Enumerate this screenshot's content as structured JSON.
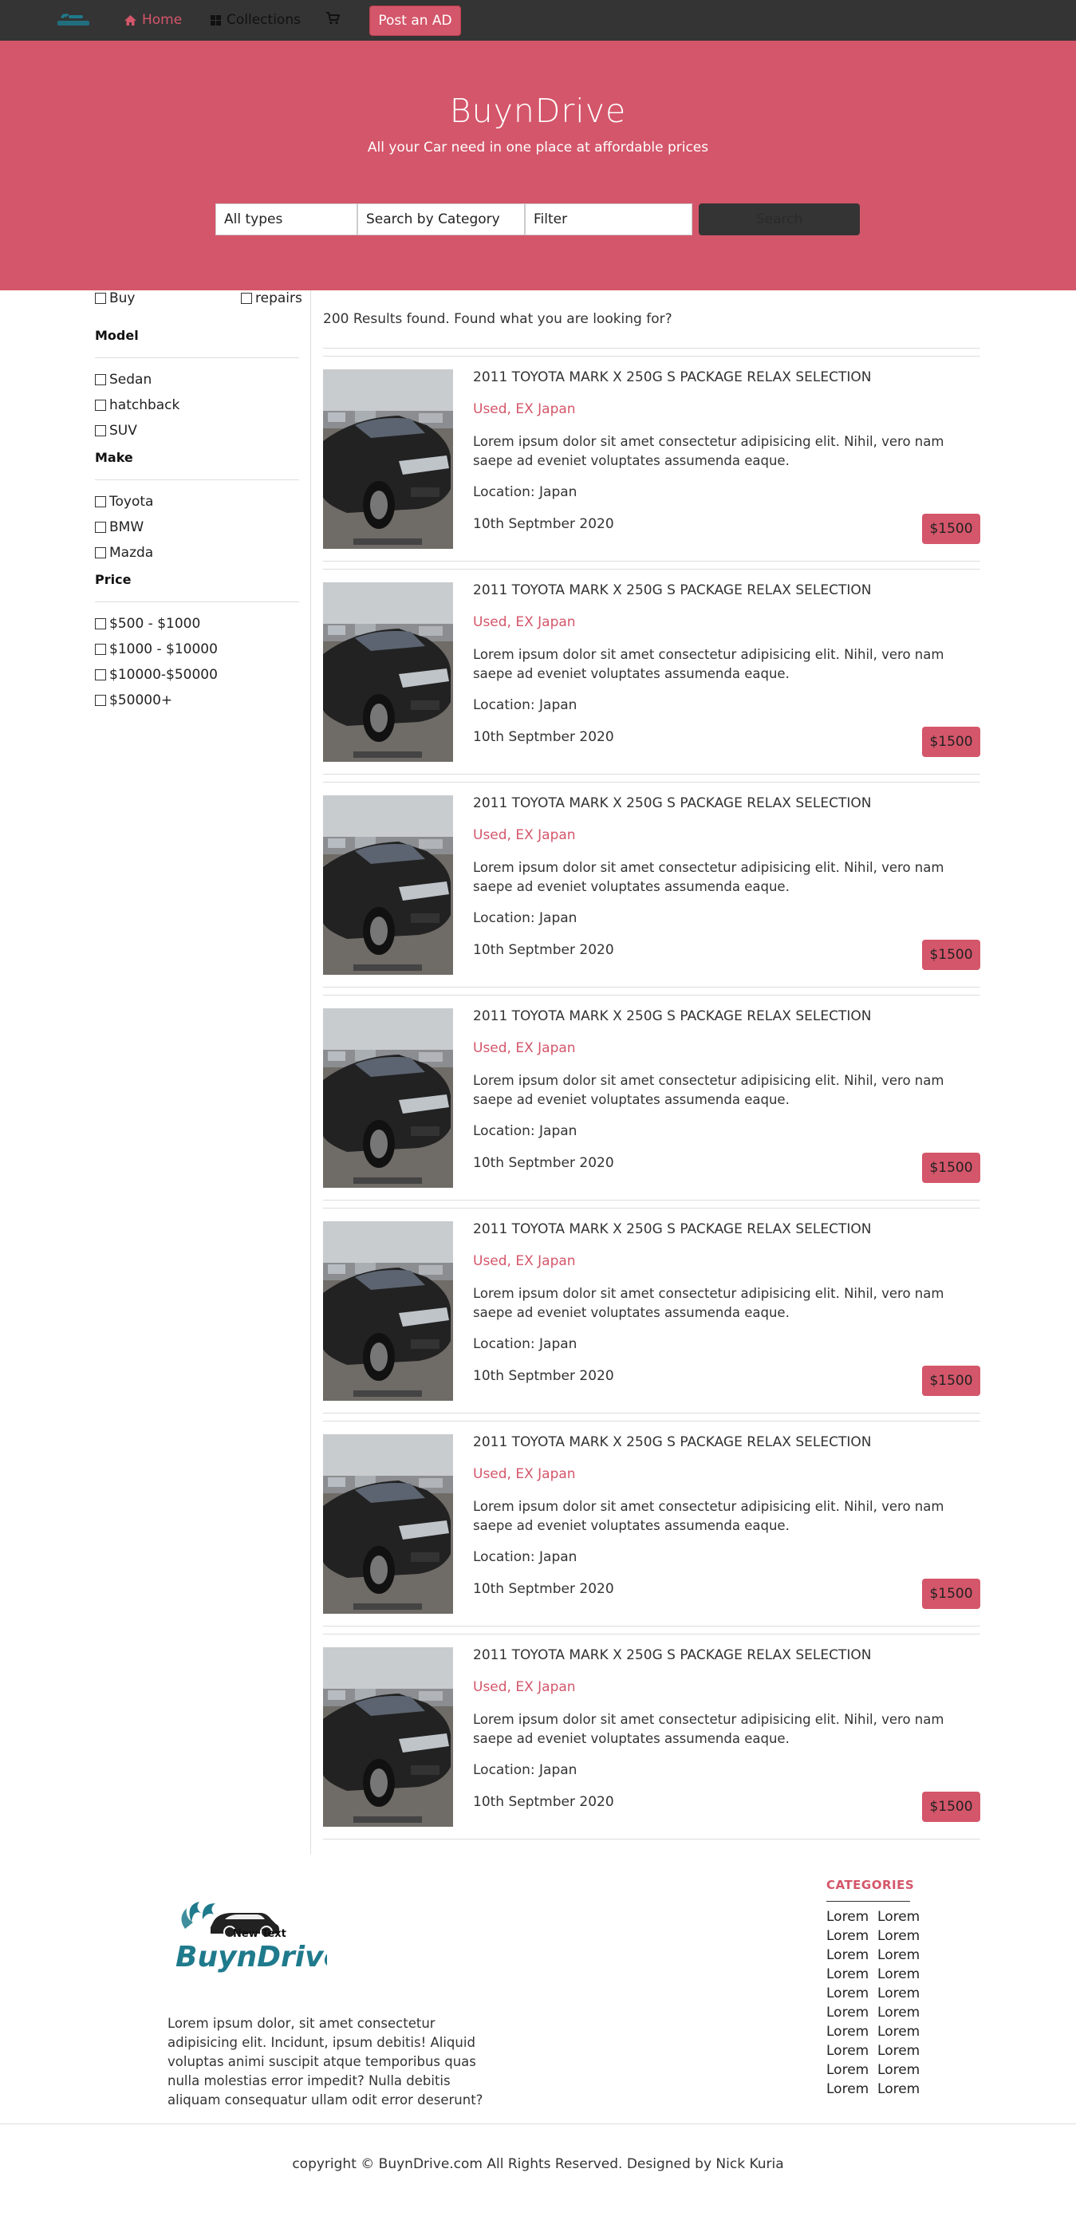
{
  "nav": {
    "home": "Home",
    "collections": "Collections",
    "post_ad": "Post an AD"
  },
  "hero": {
    "title": "BuynDrive",
    "subtitle": "All your Car need in one place at affordable prices",
    "select_types": "All types",
    "select_category": "Search by Category",
    "select_filter": "Filter",
    "search_button": "Search"
  },
  "sidebar": {
    "buy": "Buy",
    "repairs": "repairs",
    "model_heading": "Model",
    "models": [
      "Sedan",
      "hatchback",
      "SUV"
    ],
    "make_heading": "Make",
    "makes": [
      "Toyota",
      "BMW",
      "Mazda"
    ],
    "price_heading": "Price",
    "prices": [
      "$500 - $1000",
      "$1000 - $10000",
      "$10000-$50000",
      "$50000+"
    ]
  },
  "results": {
    "count_text": "200 Results found. Found what you are looking for?",
    "listings": [
      {
        "title": "2011 TOYOTA MARK X 250G S PACKAGE RELAX SELECTION",
        "condition": "Used, EX Japan",
        "desc": "Lorem ipsum dolor sit amet consectetur adipisicing elit. Nihil, vero nam saepe ad eveniet voluptates assumenda eaque.",
        "location": "Location: Japan",
        "date": "10th Septmber 2020",
        "price": "$1500"
      },
      {
        "title": "2011 TOYOTA MARK X 250G S PACKAGE RELAX SELECTION",
        "condition": "Used, EX Japan",
        "desc": "Lorem ipsum dolor sit amet consectetur adipisicing elit. Nihil, vero nam saepe ad eveniet voluptates assumenda eaque.",
        "location": "Location: Japan",
        "date": "10th Septmber 2020",
        "price": "$1500"
      },
      {
        "title": "2011 TOYOTA MARK X 250G S PACKAGE RELAX SELECTION",
        "condition": "Used, EX Japan",
        "desc": "Lorem ipsum dolor sit amet consectetur adipisicing elit. Nihil, vero nam saepe ad eveniet voluptates assumenda eaque.",
        "location": "Location: Japan",
        "date": "10th Septmber 2020",
        "price": "$1500"
      },
      {
        "title": "2011 TOYOTA MARK X 250G S PACKAGE RELAX SELECTION",
        "condition": "Used, EX Japan",
        "desc": "Lorem ipsum dolor sit amet consectetur adipisicing elit. Nihil, vero nam saepe ad eveniet voluptates assumenda eaque.",
        "location": "Location: Japan",
        "date": "10th Septmber 2020",
        "price": "$1500"
      },
      {
        "title": "2011 TOYOTA MARK X 250G S PACKAGE RELAX SELECTION",
        "condition": "Used, EX Japan",
        "desc": "Lorem ipsum dolor sit amet consectetur adipisicing elit. Nihil, vero nam saepe ad eveniet voluptates assumenda eaque.",
        "location": "Location: Japan",
        "date": "10th Septmber 2020",
        "price": "$1500"
      },
      {
        "title": "2011 TOYOTA MARK X 250G S PACKAGE RELAX SELECTION",
        "condition": "Used, EX Japan",
        "desc": "Lorem ipsum dolor sit amet consectetur adipisicing elit. Nihil, vero nam saepe ad eveniet voluptates assumenda eaque.",
        "location": "Location: Japan",
        "date": "10th Septmber 2020",
        "price": "$1500"
      },
      {
        "title": "2011 TOYOTA MARK X 250G S PACKAGE RELAX SELECTION",
        "condition": "Used, EX Japan",
        "desc": "Lorem ipsum dolor sit amet consectetur adipisicing elit. Nihil, vero nam saepe ad eveniet voluptates assumenda eaque.",
        "location": "Location: Japan",
        "date": "10th Septmber 2020",
        "price": "$1500"
      }
    ]
  },
  "footer": {
    "logo_text": "BuynDrive",
    "logo_subtext": "New Text",
    "about": "Lorem ipsum dolor, sit amet consectetur adipisicing elit. Incidunt, ipsum debitis! Aliquid voluptas animi suscipit atque temporibus quas nulla molestias error impedit? Nulla debitis aliquam consequatur ullam odit error deserunt?",
    "categories_heading": "CATEGORIES",
    "categories": [
      "Lorem  Lorem",
      "Lorem  Lorem",
      "Lorem  Lorem",
      "Lorem  Lorem",
      "Lorem  Lorem",
      "Lorem  Lorem",
      "Lorem  Lorem",
      "Lorem  Lorem",
      "Lorem  Lorem",
      "Lorem  Lorem"
    ],
    "copyright": "copyright © BuynDrive.com All Rights Reserved. Designed by Nick Kuria"
  },
  "colors": {
    "brand": "#d4566a",
    "navbar": "#343434",
    "logo_teal": "#1f7a8c"
  },
  "icons": {
    "home": "home-icon",
    "collections": "grid-icon",
    "cart": "cart-icon"
  }
}
